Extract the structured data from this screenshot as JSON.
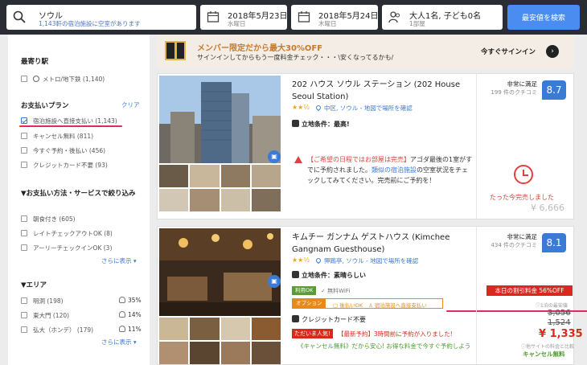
{
  "search_bar": {
    "destination": "ソウル",
    "destination_sub": "1,143軒の宿泊施設に空室があります",
    "checkin_date": "2018年5月23日",
    "checkin_day": "水曜日",
    "checkout_date": "2018年5月24日",
    "checkout_day": "木曜日",
    "guests": "大人1名, 子ども0名",
    "rooms": "1部屋",
    "search_button": "最安値を検索"
  },
  "sidebar": {
    "station_heading": "最寄り駅",
    "station_items": [
      {
        "label": "メトロ/地下鉄 (1,140)"
      }
    ],
    "payment_heading": "お支払いプラン",
    "payment_clear": "クリア",
    "payment_items": [
      {
        "label": "宿泊施設へ直接支払い (1,143)",
        "checked": true
      },
      {
        "label": "キャンセル無料 (811)",
        "checked": false
      },
      {
        "label": "今すぐ予約・後払い (456)",
        "checked": false
      },
      {
        "label": "クレジットカード不要 (93)",
        "checked": false
      }
    ],
    "service_heading": "▼お支払い方法・サービスで絞り込み",
    "service_items": [
      {
        "label": "朝食付き (605)"
      },
      {
        "label": "レイトチェックアウトOK (8)"
      },
      {
        "label": "アーリーチェックインOK (3)"
      }
    ],
    "more_link": "さらに表示 ▾",
    "area_heading": "▼エリア",
    "area_items": [
      {
        "label": "明洞 (198)",
        "pct": "35%"
      },
      {
        "label": "東大門 (120)",
        "pct": "14%"
      },
      {
        "label": "弘大（ホンデ） (179)",
        "pct": "11%"
      }
    ],
    "area_more": "さらに表示 ▾"
  },
  "banner": {
    "title": "メンバー限定だから最大30%OFF",
    "subtitle": "サインインしてからもう一度料金チェック・・・\\安くなってるかも/",
    "cta": "今すぐサインイン",
    "arrow": "›"
  },
  "hotels": [
    {
      "name": "202 ハウス ソウル ステーション (202 House Seoul Station)",
      "stars": "★★½",
      "location": "中区, ソウル - 地図で場所を確認",
      "condition": "立地条件：最高!",
      "review_label": "非常に満足",
      "review_count": "199 件のクチコミ",
      "score": "8.7",
      "soldout_red": "【ご希望の日程ではお部屋は完売】",
      "soldout_text1": "アゴダ最後の1室がすでに予約されました。",
      "soldout_link": "類似の宿泊施設",
      "soldout_text2": "の空室状況をチェックしてみてください。完売前にご予約を！",
      "sold_label": "たった今完売しました",
      "sold_price": "¥ 6,666"
    },
    {
      "name": "キムチー ガンナム ゲストハウス (Kimchee Gangnam Guesthouse)",
      "stars": "★★½",
      "location": "狎鴎亭, ソウル - 地図で場所を確認",
      "condition": "立地条件：素晴らしい",
      "review_label": "非常に満足",
      "review_count": "434 件のクチコミ",
      "score": "8.1",
      "tag_usage": "利用OK",
      "tag_usage_text": "無料WiFi",
      "tag_option": "オプション",
      "option_1": "後払いOK",
      "option_2": "宿泊施設へ直接支払い",
      "no_card": "クレジットカード不要",
      "popular": "ただいま人気!",
      "recent": "【最新予約】3時間前に予約が入りました!",
      "free_cancel": "《キャンセル無料》だから安心! お得な料金で今すぐ予約しよう",
      "discount": "本日の割引料金 56%OFF",
      "price_note1": "1泊の最安値",
      "price_old1": "3,056",
      "price_old2": "1,524",
      "price_final": "¥ 1,335",
      "price_note2": "他サイトの料金と比較",
      "free_cancel_short": "キャンセル無料"
    }
  ],
  "colors": {
    "accent": "#3a7bd5",
    "annotation": "#e02a62",
    "danger": "#d9281c"
  }
}
